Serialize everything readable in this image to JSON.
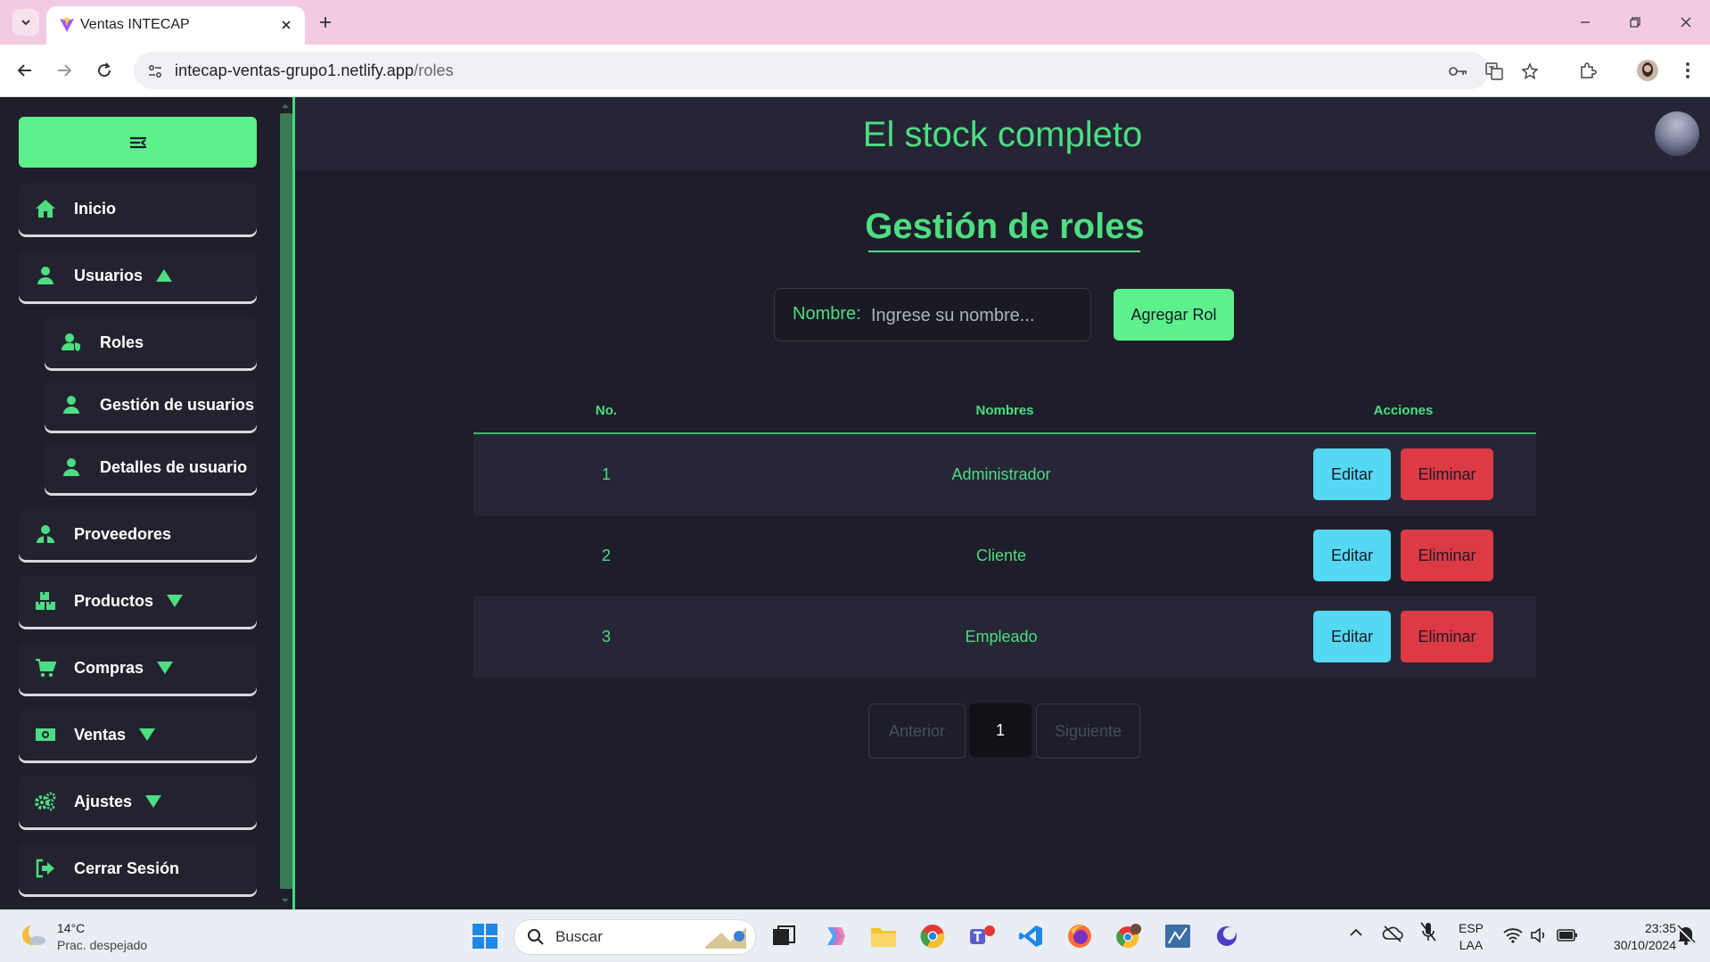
{
  "browser": {
    "tab_title": "Ventas INTECAP",
    "url_host": "intecap-ventas-grupo1.netlify.app",
    "url_path": "/roles"
  },
  "app": {
    "title": "El stock completo"
  },
  "sidebar": {
    "items": [
      {
        "label": "Inicio",
        "icon": "home-icon"
      },
      {
        "label": "Usuarios",
        "icon": "user-icon",
        "expanded": true
      },
      {
        "label": "Roles",
        "icon": "user-shield-icon"
      },
      {
        "label": "Gestión de usuarios",
        "icon": "user-icon"
      },
      {
        "label": "Detalles de usuario",
        "icon": "user-icon"
      },
      {
        "label": "Proveedores",
        "icon": "supplier-icon"
      },
      {
        "label": "Productos",
        "icon": "boxes-icon",
        "expanded": false
      },
      {
        "label": "Compras",
        "icon": "cart-icon",
        "expanded": false
      },
      {
        "label": "Ventas",
        "icon": "money-icon",
        "expanded": false
      },
      {
        "label": "Ajustes",
        "icon": "gears-icon",
        "expanded": false
      },
      {
        "label": "Cerrar Sesión",
        "icon": "logout-icon"
      }
    ]
  },
  "page": {
    "title": "Gestión de roles",
    "search_label": "Nombre:",
    "search_placeholder": "Ingrese su nombre...",
    "add_button": "Agregar Rol"
  },
  "table": {
    "headers": [
      "No.",
      "Nombres",
      "Acciones"
    ],
    "rows": [
      {
        "no": "1",
        "name": "Administrador",
        "edit": "Editar",
        "delete": "Eliminar"
      },
      {
        "no": "2",
        "name": "Cliente",
        "edit": "Editar",
        "delete": "Eliminar"
      },
      {
        "no": "3",
        "name": "Empleado",
        "edit": "Editar",
        "delete": "Eliminar"
      }
    ]
  },
  "pagination": {
    "prev": "Anterior",
    "current": "1",
    "next": "Siguiente"
  },
  "taskbar": {
    "weather_temp": "14°C",
    "weather_desc": "Prac. despejado",
    "search_label": "Buscar",
    "lang_top": "ESP",
    "lang_bottom": "LAA",
    "time": "23:35",
    "date": "30/10/2024"
  },
  "colors": {
    "accent": "#4ddd82",
    "button_green": "#5ef08d",
    "edit_blue": "#55d8f2",
    "delete_red": "#dc3a45",
    "background": "#1e1e2a"
  }
}
